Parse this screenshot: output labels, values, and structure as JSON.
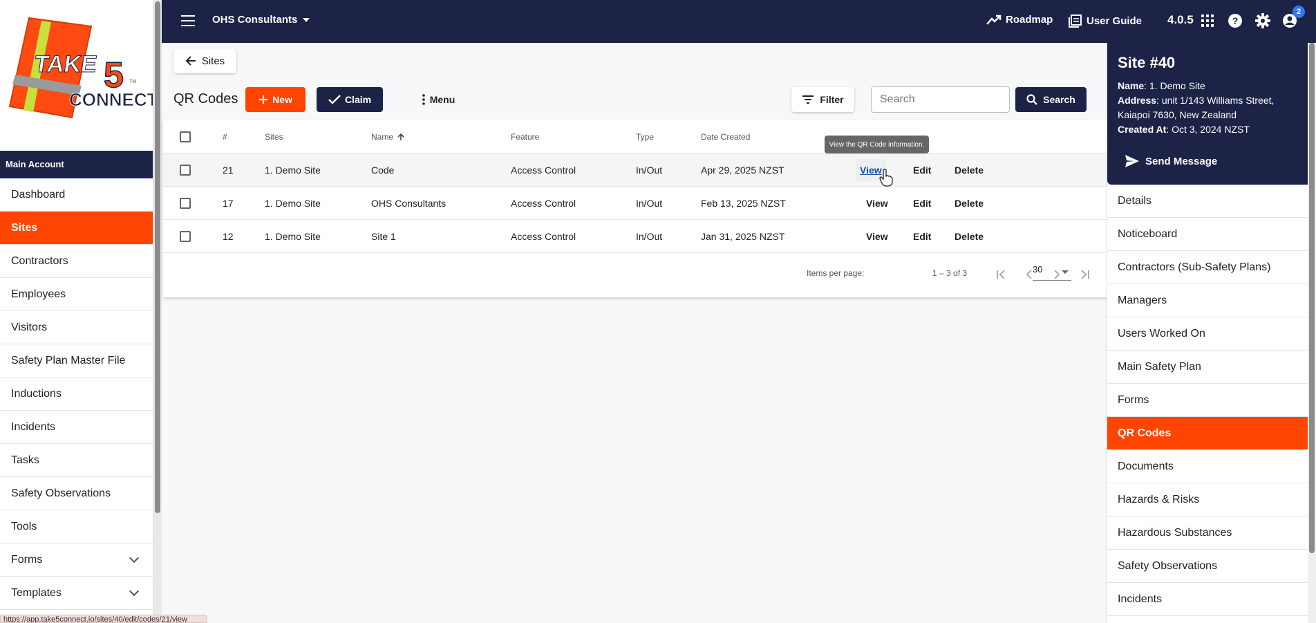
{
  "brand": {
    "logo_take": "TAKE",
    "logo_five": "5",
    "logo_connect": "CONNECT",
    "logo_tm": "TM"
  },
  "sidebar": {
    "account_header": "Main Account",
    "items": [
      {
        "label": "Dashboard"
      },
      {
        "label": "Sites"
      },
      {
        "label": "Contractors"
      },
      {
        "label": "Employees"
      },
      {
        "label": "Visitors"
      },
      {
        "label": "Safety Plan Master File"
      },
      {
        "label": "Inductions"
      },
      {
        "label": "Incidents"
      },
      {
        "label": "Tasks"
      },
      {
        "label": "Safety Observations"
      },
      {
        "label": "Tools"
      },
      {
        "label": "Forms"
      },
      {
        "label": "Templates"
      }
    ],
    "active_index": 1
  },
  "status_bar": {
    "url": "https://app.take5connect.io/sites/40/edit/codes/21/view"
  },
  "topbar": {
    "org_name": "OHS Consultants",
    "roadmap": "Roadmap",
    "user_guide": "User Guide",
    "version": "4.0.5",
    "notification_count": "2",
    "colors": {
      "navy": "#1c2347",
      "accent": "#ff4500"
    }
  },
  "toolbar": {
    "back_label": "Sites",
    "page_title": "QR Codes",
    "new_label": "New",
    "claim_label": "Claim",
    "menu_label": "Menu",
    "filter_label": "Filter",
    "search_placeholder": "Search",
    "search_label": "Search"
  },
  "table": {
    "headers": {
      "num": "#",
      "sites": "Sites",
      "name": "Name",
      "feature": "Feature",
      "type": "Type",
      "date": "Date Created"
    },
    "rows": [
      {
        "num": "21",
        "site": "1. Demo Site",
        "name": "Code",
        "feature": "Access Control",
        "type": "In/Out",
        "date": "Apr 29, 2025 NZST"
      },
      {
        "num": "17",
        "site": "1. Demo Site",
        "name": "OHS Consultants",
        "feature": "Access Control",
        "type": "In/Out",
        "date": "Feb 13, 2025 NZST"
      },
      {
        "num": "12",
        "site": "1. Demo Site",
        "name": "Site 1",
        "feature": "Access Control",
        "type": "In/Out",
        "date": "Jan 31, 2025 NZST"
      }
    ],
    "actions": {
      "view": "View",
      "edit": "Edit",
      "delete": "Delete"
    },
    "tooltip": "View the QR Code information.",
    "pagination": {
      "items_per_page_label": "Items per page:",
      "items_per_page": "30",
      "range": "1 – 3 of 3"
    }
  },
  "site_panel": {
    "title": "Site #40",
    "name_label": "Name",
    "name": "1. Demo Site",
    "address_label": "Address",
    "address_line1": "unit 1/143 Williams Street,",
    "address_line2": "Kaiapoi 7630, New Zealand",
    "created_label": "Created At",
    "created": "Oct 3, 2024 NZST",
    "send_message": "Send Message",
    "items": [
      {
        "label": "Details"
      },
      {
        "label": "Noticeboard"
      },
      {
        "label": "Contractors (Sub-Safety Plans)"
      },
      {
        "label": "Managers"
      },
      {
        "label": "Users Worked On"
      },
      {
        "label": "Main Safety Plan"
      },
      {
        "label": "Forms"
      },
      {
        "label": "QR Codes"
      },
      {
        "label": "Documents"
      },
      {
        "label": "Hazards & Risks"
      },
      {
        "label": "Hazardous Substances"
      },
      {
        "label": "Safety Observations"
      },
      {
        "label": "Incidents"
      }
    ],
    "active_index": 7
  }
}
